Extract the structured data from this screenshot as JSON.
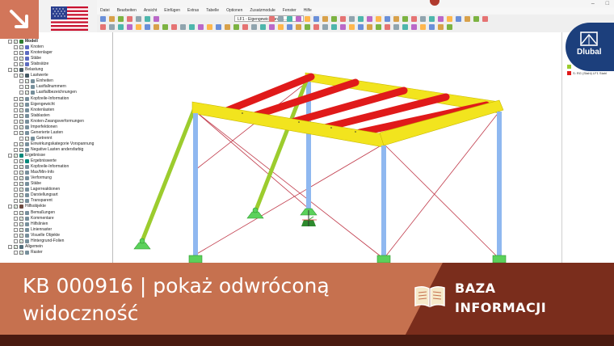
{
  "app": {
    "menu": [
      "Datei",
      "Bearbeiten",
      "Ansicht",
      "Einfügen",
      "Extras",
      "Tabelle",
      "Optionen",
      "Zusatzmodule",
      "Fenster",
      "Hilfe"
    ],
    "load_case": "LF1 - Eigengewicht und A..."
  },
  "navigator": {
    "rows": [
      {
        "label": "Modell",
        "bold": true
      },
      {
        "label": "Knoten"
      },
      {
        "label": "Knotenlager"
      },
      {
        "label": "Stäbe"
      },
      {
        "label": "Stabsätze"
      },
      {
        "label": "Belastung"
      },
      {
        "label": "Lastwerte"
      },
      {
        "label": "Einheiten"
      },
      {
        "label": "Lastfallnummern"
      },
      {
        "label": "Lastfallbezeichnungen"
      },
      {
        "label": "Kopfzeile-Information"
      },
      {
        "label": "Eigengewicht"
      },
      {
        "label": "Knotenlasten"
      },
      {
        "label": "Stablasten"
      },
      {
        "label": "Knoten-Zwangsverformungen"
      },
      {
        "label": "Imperfektionen"
      },
      {
        "label": "Generierte Lasten"
      },
      {
        "label": "Getrennt"
      },
      {
        "label": "Einwirkungskategorie Vorspannung"
      },
      {
        "label": "Negative Lasten andersfarbig"
      },
      {
        "label": "Ergebnisse"
      },
      {
        "label": "Ergebniswerte"
      },
      {
        "label": "Kopfzeile-Information"
      },
      {
        "label": "Max/Min-Info"
      },
      {
        "label": "Verformung"
      },
      {
        "label": "Stäbe"
      },
      {
        "label": "Lagerreaktionen"
      },
      {
        "label": "Darstellungsart"
      },
      {
        "label": "Transparent"
      },
      {
        "label": "Hilfsobjekte"
      },
      {
        "label": "Bemaßungen"
      },
      {
        "label": "Kommentare"
      },
      {
        "label": "Hilfslinien"
      },
      {
        "label": "Linienraster"
      },
      {
        "label": "Visuelle Objekte"
      },
      {
        "label": "Hintergrund-Folien"
      },
      {
        "label": "Allgemein"
      },
      {
        "label": "Raster"
      }
    ]
  },
  "right_panel": {
    "legend_text": "S: RG (Stahl) LF1 Stahl"
  },
  "brand": {
    "logo": "Dlubal",
    "flag": "united-states-flag",
    "corner_icon": "arrow-down-right-icon"
  },
  "banner": {
    "headline": "KB 000916 | pokaż odwróconą widoczność",
    "kb_label_line1": "BAZA",
    "kb_label_line2": "INFORMACJI",
    "icon": "open-book-icon"
  },
  "colors": {
    "banner_dark": "#7a2d1c",
    "banner_light": "#c6714f",
    "beam_yellow": "#f2e41e",
    "beam_red": "#e01a1a",
    "column_blue": "#8fb8f0",
    "brace_green": "#9ccc2e",
    "support_green": "#5bd15b",
    "dlubal_blue": "#1c3f7c"
  }
}
